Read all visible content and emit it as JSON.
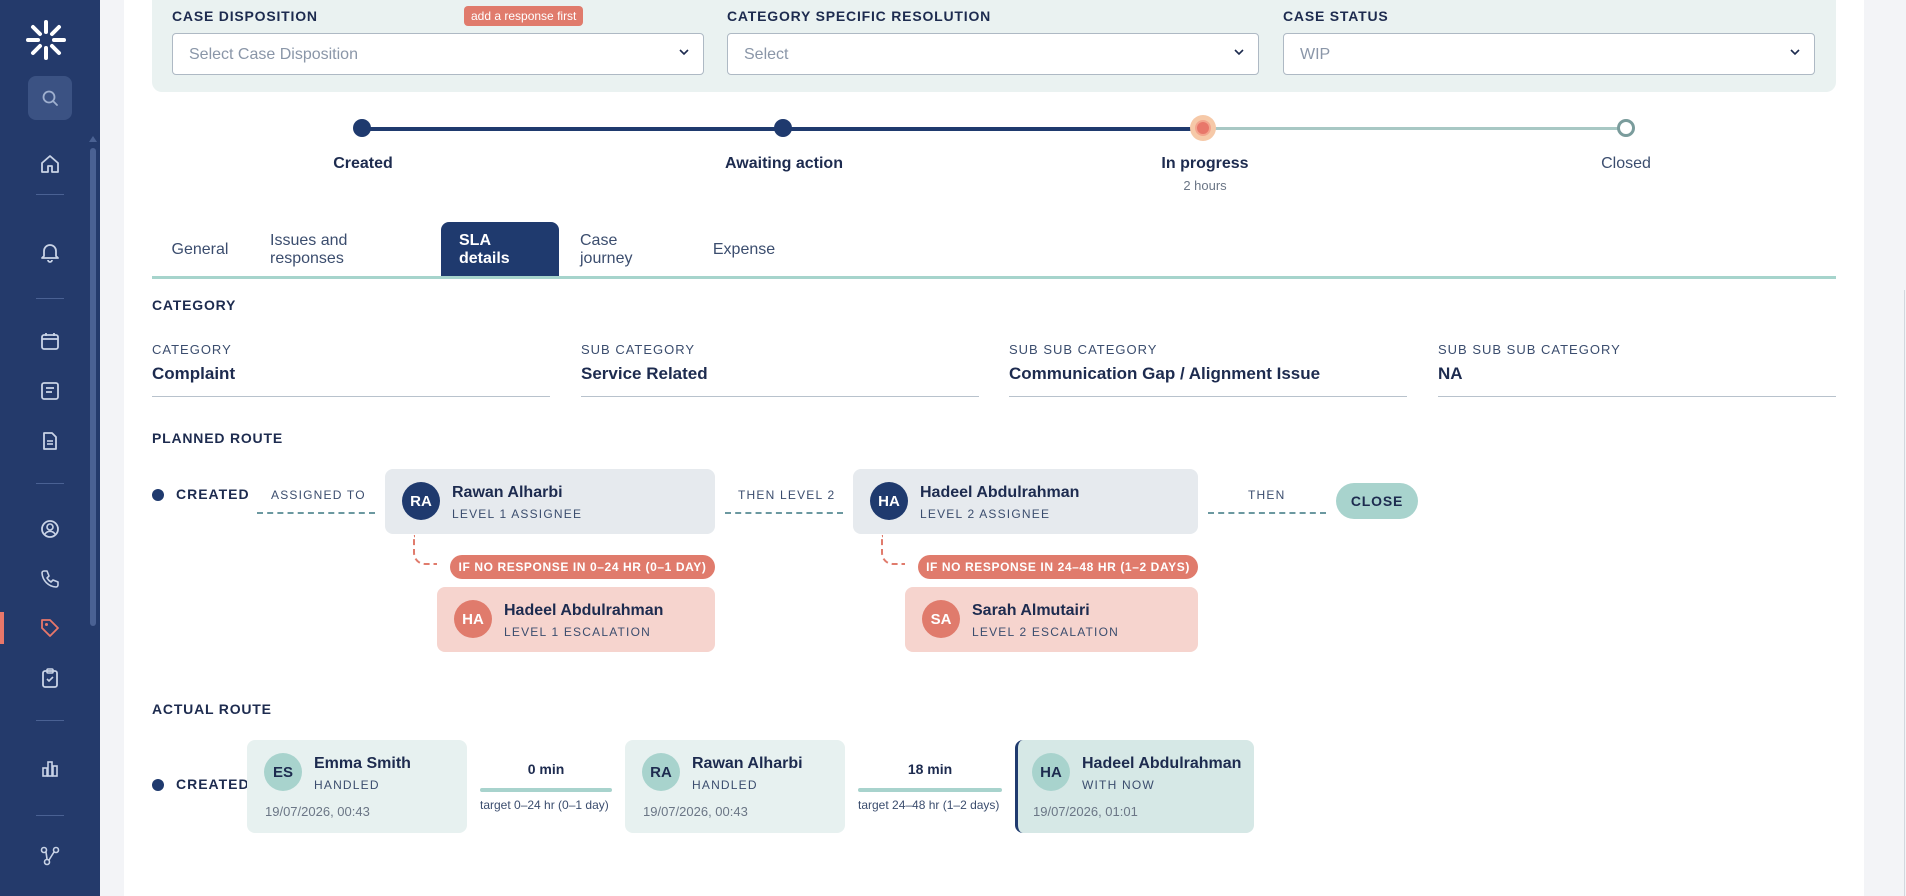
{
  "sidebar": {
    "icons": [
      "logo-icon",
      "search-icon",
      "home-icon",
      "bell-icon",
      "calendar-icon",
      "form-icon",
      "document-icon",
      "user-icon",
      "phone-icon",
      "tag-icon",
      "clipboard-check-icon",
      "chart-icon",
      "network-icon"
    ],
    "active": "tag-icon"
  },
  "disposition": {
    "case_disposition_label": "CASE DISPOSITION",
    "case_disposition_badge": "add a response first",
    "case_disposition_placeholder": "Select Case Disposition",
    "category_resolution_label": "CATEGORY SPECIFIC RESOLUTION",
    "category_resolution_placeholder": "Select",
    "case_status_label": "CASE STATUS",
    "case_status_value": "WIP"
  },
  "progress": {
    "steps": [
      {
        "label": "Created",
        "sub": ""
      },
      {
        "label": "Awaiting action",
        "sub": ""
      },
      {
        "label": "In progress",
        "sub": "2 hours"
      },
      {
        "label": "Closed",
        "sub": ""
      }
    ],
    "current_index": 2
  },
  "tabs": [
    "General",
    "Issues and responses",
    "SLA details",
    "Case journey",
    "Expense"
  ],
  "active_tab": "SLA details",
  "category_section": {
    "title": "CATEGORY",
    "fields": [
      {
        "label": "CATEGORY",
        "value": "Complaint"
      },
      {
        "label": "SUB CATEGORY",
        "value": "Service Related"
      },
      {
        "label": "SUB SUB CATEGORY",
        "value": "Communication Gap / Alignment Issue"
      },
      {
        "label": "SUB SUB SUB CATEGORY",
        "value": "NA"
      }
    ]
  },
  "planned_route": {
    "title": "PLANNED ROUTE",
    "created": "CREATED",
    "assigned_to": "ASSIGNED TO",
    "then_level2": "THEN LEVEL 2",
    "then": "THEN",
    "close": "CLOSE",
    "level1": {
      "initials": "RA",
      "name": "Rawan Alharbi",
      "role": "LEVEL 1 ASSIGNEE"
    },
    "level2": {
      "initials": "HA",
      "name": "Hadeel Abdulrahman",
      "role": "LEVEL 2 ASSIGNEE"
    },
    "esc1_condition": "IF NO RESPONSE IN 0–24 HR (0–1 DAY)",
    "esc2_condition": "IF NO RESPONSE IN 24–48 HR (1–2 DAYS)",
    "esc1": {
      "initials": "HA",
      "name": "Hadeel Abdulrahman",
      "role": "LEVEL 1 ESCALATION"
    },
    "esc2": {
      "initials": "SA",
      "name": "Sarah Almutairi",
      "role": "LEVEL 2 ESCALATION"
    }
  },
  "actual_route": {
    "title": "ACTUAL ROUTE",
    "created": "CREATED",
    "nodes": [
      {
        "initials": "ES",
        "name": "Emma Smith",
        "status": "HANDLED",
        "time": "19/07/2026, 00:43"
      },
      {
        "initials": "RA",
        "name": "Rawan Alharbi",
        "status": "HANDLED",
        "time": "19/07/2026, 00:43"
      },
      {
        "initials": "HA",
        "name": "Hadeel Abdulrahman",
        "status": "WITH NOW",
        "time": "19/07/2026, 01:01"
      }
    ],
    "segments": [
      {
        "duration": "0 min",
        "target": "target 0–24 hr (0–1 day)"
      },
      {
        "duration": "18 min",
        "target": "target 24–48 hr (1–2 days)"
      }
    ]
  }
}
